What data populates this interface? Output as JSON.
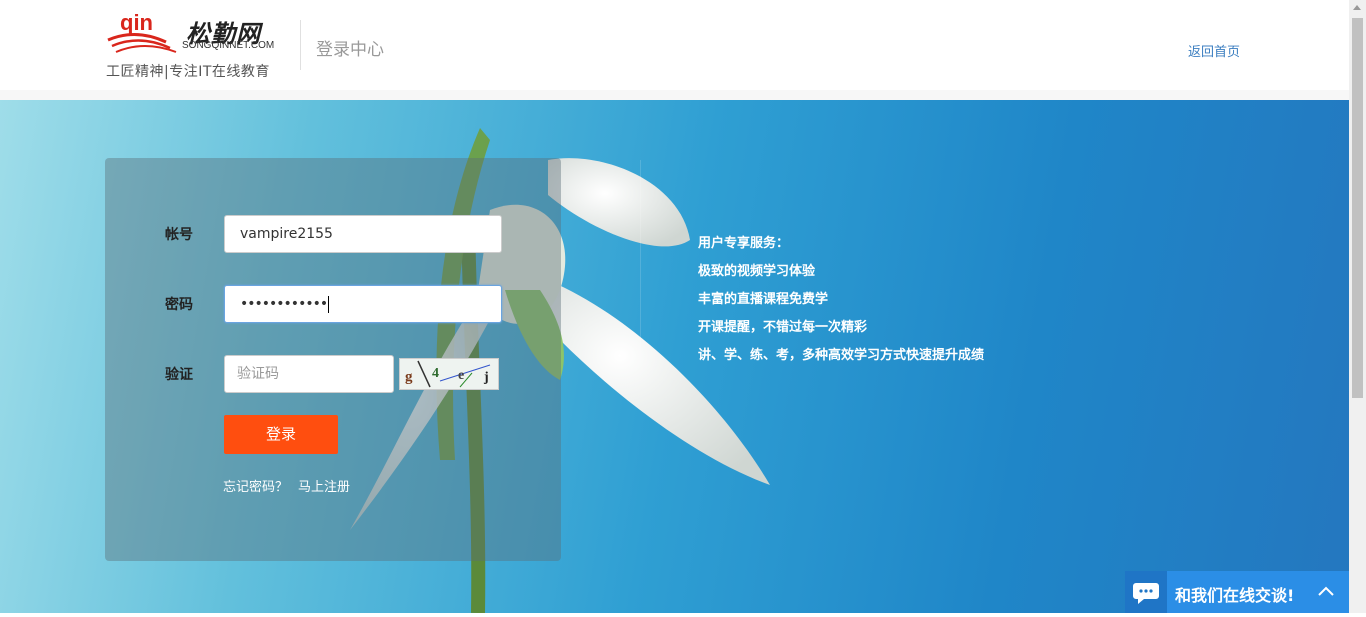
{
  "header": {
    "logo_name": "松勤网",
    "logo_domain": "SONGQINNET.COM",
    "logo_slogan": "工匠精神|专注IT在线教育",
    "center_title": "登录中心",
    "home_link": "返回首页"
  },
  "login": {
    "account_label": "帐号",
    "account_value": "vampire2155",
    "password_label": "密码",
    "password_masked": "••••••••••••",
    "captcha_label": "验证",
    "captcha_placeholder": "验证码",
    "captcha_chars": [
      "g",
      "4",
      "e",
      "j"
    ],
    "login_button": "登录",
    "forgot_link": "忘记密码？",
    "register_link": "马上注册"
  },
  "features": {
    "title": "用户专享服务：",
    "items": [
      "极致的视频学习体验",
      "丰富的直播课程免费学",
      "开课提醒，不错过每一次精彩",
      "讲、学、练、考，多种高效学习方式快速提升成绩"
    ]
  },
  "chat": {
    "label": "和我们在线交谈!"
  },
  "colors": {
    "accent_orange": "#ff4e0f",
    "link_blue": "#3b7ec0",
    "chat_blue": "#2b8ee6"
  }
}
